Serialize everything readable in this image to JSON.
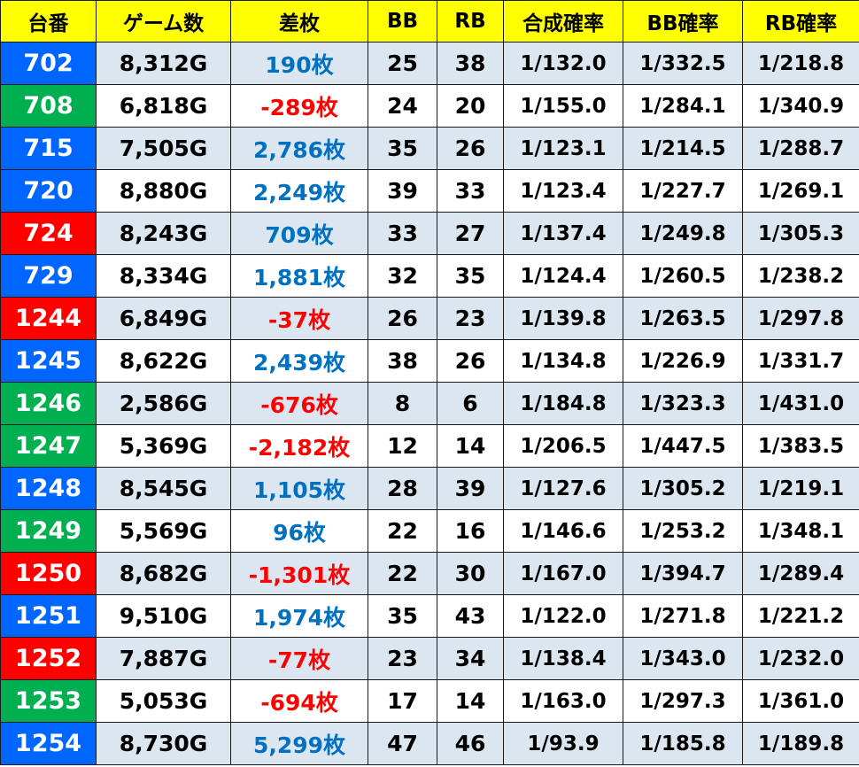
{
  "headers": [
    "台番",
    "ゲーム数",
    "差枚",
    "BB",
    "RB",
    "合成確率",
    "BB確率",
    "RB確率"
  ],
  "colors": {
    "header_bg": "#ffff00",
    "row_shade": "#dce6f1",
    "machine_blue": "#0066ff",
    "machine_green": "#00b050",
    "machine_red": "#ff0000",
    "diff_positive": "#0070c0",
    "diff_negative": "#ff0000"
  },
  "rows": [
    {
      "num": "702",
      "color": "blue",
      "games": "8,312G",
      "diff": "190枚",
      "sign": "pos",
      "bb": "25",
      "rb": "38",
      "total": "1/132.0",
      "bbp": "1/332.5",
      "rbp": "1/218.8"
    },
    {
      "num": "708",
      "color": "green",
      "games": "6,818G",
      "diff": "-289枚",
      "sign": "neg",
      "bb": "24",
      "rb": "20",
      "total": "1/155.0",
      "bbp": "1/284.1",
      "rbp": "1/340.9"
    },
    {
      "num": "715",
      "color": "blue",
      "games": "7,505G",
      "diff": "2,786枚",
      "sign": "pos",
      "bb": "35",
      "rb": "26",
      "total": "1/123.1",
      "bbp": "1/214.5",
      "rbp": "1/288.7"
    },
    {
      "num": "720",
      "color": "blue",
      "games": "8,880G",
      "diff": "2,249枚",
      "sign": "pos",
      "bb": "39",
      "rb": "33",
      "total": "1/123.4",
      "bbp": "1/227.7",
      "rbp": "1/269.1"
    },
    {
      "num": "724",
      "color": "red",
      "games": "8,243G",
      "diff": "709枚",
      "sign": "pos",
      "bb": "33",
      "rb": "27",
      "total": "1/137.4",
      "bbp": "1/249.8",
      "rbp": "1/305.3"
    },
    {
      "num": "729",
      "color": "blue",
      "games": "8,334G",
      "diff": "1,881枚",
      "sign": "pos",
      "bb": "32",
      "rb": "35",
      "total": "1/124.4",
      "bbp": "1/260.5",
      "rbp": "1/238.2"
    },
    {
      "num": "1244",
      "color": "red",
      "games": "6,849G",
      "diff": "-37枚",
      "sign": "neg",
      "bb": "26",
      "rb": "23",
      "total": "1/139.8",
      "bbp": "1/263.5",
      "rbp": "1/297.8"
    },
    {
      "num": "1245",
      "color": "blue",
      "games": "8,622G",
      "diff": "2,439枚",
      "sign": "pos",
      "bb": "38",
      "rb": "26",
      "total": "1/134.8",
      "bbp": "1/226.9",
      "rbp": "1/331.7"
    },
    {
      "num": "1246",
      "color": "green",
      "games": "2,586G",
      "diff": "-676枚",
      "sign": "neg",
      "bb": "8",
      "rb": "6",
      "total": "1/184.8",
      "bbp": "1/323.3",
      "rbp": "1/431.0"
    },
    {
      "num": "1247",
      "color": "green",
      "games": "5,369G",
      "diff": "-2,182枚",
      "sign": "neg",
      "bb": "12",
      "rb": "14",
      "total": "1/206.5",
      "bbp": "1/447.5",
      "rbp": "1/383.5"
    },
    {
      "num": "1248",
      "color": "blue",
      "games": "8,545G",
      "diff": "1,105枚",
      "sign": "pos",
      "bb": "28",
      "rb": "39",
      "total": "1/127.6",
      "bbp": "1/305.2",
      "rbp": "1/219.1"
    },
    {
      "num": "1249",
      "color": "green",
      "games": "5,569G",
      "diff": "96枚",
      "sign": "pos",
      "bb": "22",
      "rb": "16",
      "total": "1/146.6",
      "bbp": "1/253.2",
      "rbp": "1/348.1"
    },
    {
      "num": "1250",
      "color": "red",
      "games": "8,682G",
      "diff": "-1,301枚",
      "sign": "neg",
      "bb": "22",
      "rb": "30",
      "total": "1/167.0",
      "bbp": "1/394.7",
      "rbp": "1/289.4"
    },
    {
      "num": "1251",
      "color": "blue",
      "games": "9,510G",
      "diff": "1,974枚",
      "sign": "pos",
      "bb": "35",
      "rb": "43",
      "total": "1/122.0",
      "bbp": "1/271.8",
      "rbp": "1/221.2"
    },
    {
      "num": "1252",
      "color": "red",
      "games": "7,887G",
      "diff": "-77枚",
      "sign": "neg",
      "bb": "23",
      "rb": "34",
      "total": "1/138.4",
      "bbp": "1/343.0",
      "rbp": "1/232.0"
    },
    {
      "num": "1253",
      "color": "green",
      "games": "5,053G",
      "diff": "-694枚",
      "sign": "neg",
      "bb": "17",
      "rb": "14",
      "total": "1/163.0",
      "bbp": "1/297.3",
      "rbp": "1/361.0"
    },
    {
      "num": "1254",
      "color": "blue",
      "games": "8,730G",
      "diff": "5,299枚",
      "sign": "pos",
      "bb": "47",
      "rb": "46",
      "total": "1/93.9",
      "bbp": "1/185.8",
      "rbp": "1/189.8"
    }
  ]
}
